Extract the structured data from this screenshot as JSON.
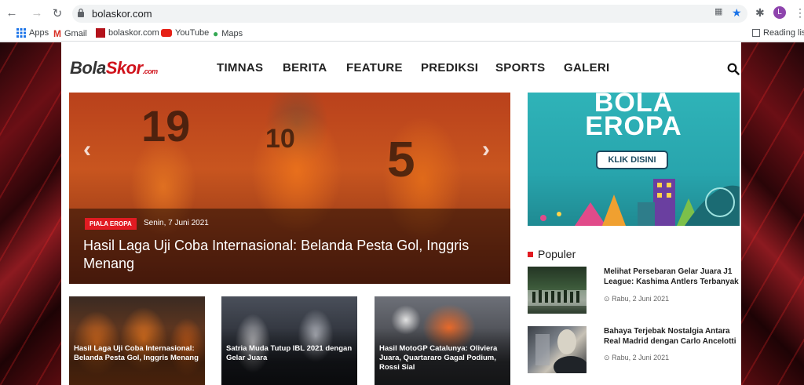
{
  "browser": {
    "url": "bolaskor.com",
    "avatar_letter": "L",
    "bookmarks": [
      "Apps",
      "Gmail",
      "bolaskor.com",
      "YouTube",
      "Maps"
    ],
    "reading_list": "Reading list"
  },
  "site": {
    "logo_main": "Bola",
    "logo_red": "Skor",
    "logo_suffix": ".com",
    "nav": [
      "TIMNAS",
      "BERITA",
      "FEATURE",
      "PREDIKSI",
      "SPORTS",
      "GALERI"
    ]
  },
  "hero": {
    "tag": "PIALA EROPA",
    "date": "Senin, 7 Juni 2021",
    "title": "Hasil Laga Uji Coba Internasional: Belanda Pesta Gol, Inggris Menang",
    "jersey_numbers": [
      "19",
      "10",
      "5"
    ]
  },
  "ad": {
    "line1": "BOLA",
    "line2": "EROPA",
    "button": "KLIK DISINI"
  },
  "popular": {
    "heading": "Populer",
    "items": [
      {
        "title": "Melihat Persebaran Gelar Juara J1 League: Kashima Antlers Terbanyak",
        "date": "Rabu, 2 Juni 2021"
      },
      {
        "title": "Bahaya Terjebak Nostalgia Antara Real Madrid dengan Carlo Ancelotti",
        "date": "Rabu, 2 Juni 2021"
      }
    ]
  },
  "cards": [
    {
      "title": "Hasil Laga Uji Coba Internasional: Belanda Pesta Gol, Inggris Menang"
    },
    {
      "title": "Satria Muda Tutup IBL 2021 dengan Gelar Juara"
    },
    {
      "title": "Hasil MotoGP Catalunya: Oliviera Juara, Quartararo Gagal Podium, Rossi Sial"
    }
  ],
  "colors": {
    "accent": "#e11b22",
    "ad_bg": "#2fb3b8"
  }
}
